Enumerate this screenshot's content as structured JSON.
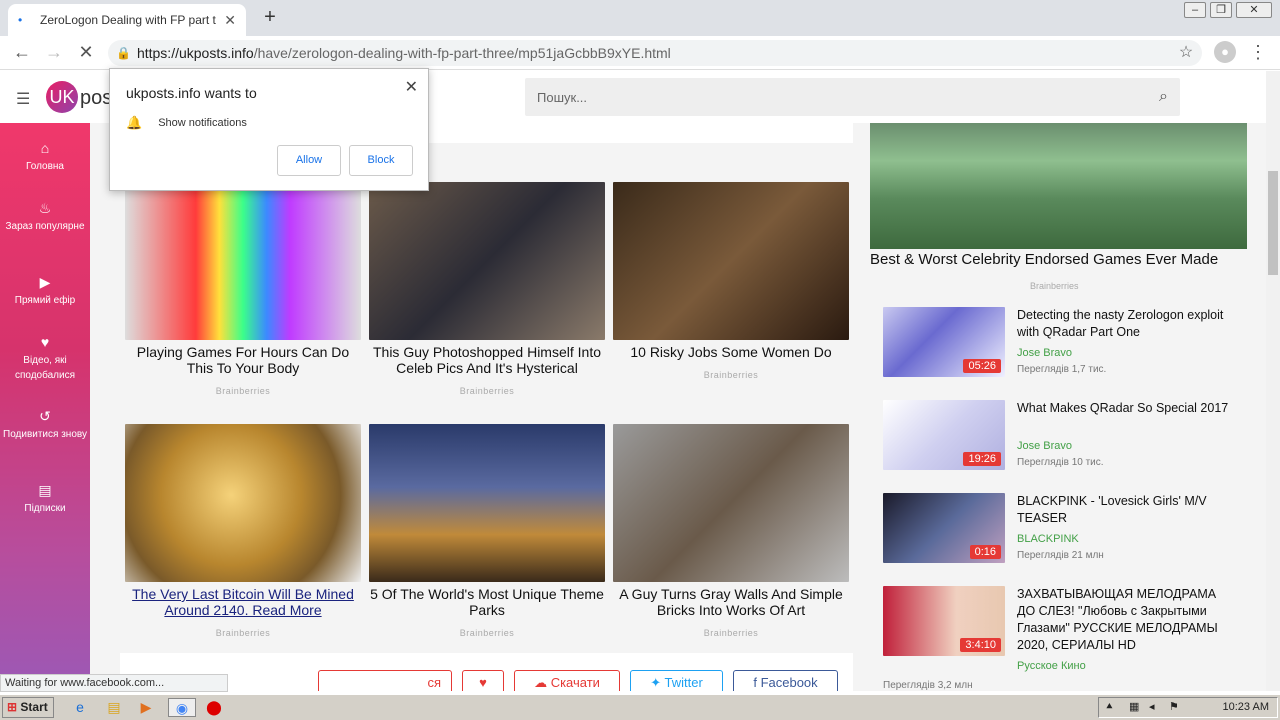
{
  "browser": {
    "tab_title": "ZeroLogon Dealing with FP part thre",
    "url_host": "https://ukposts.info",
    "url_path": "/have/zerologon-dealing-with-fp-part-three/mp51jaGcbbB9xYE.html",
    "status_text": "Waiting for www.facebook.com..."
  },
  "popup": {
    "title": "ukposts.info wants to",
    "permission": "Show notifications",
    "allow_label": "Allow",
    "block_label": "Block"
  },
  "site": {
    "logo_badge": "UK",
    "logo_text": "post",
    "search_placeholder": "Пошук..."
  },
  "sidebar": {
    "items": [
      {
        "label": "Головна",
        "icon": "home-icon"
      },
      {
        "label": "Зараз популярне",
        "icon": "fire-icon"
      },
      {
        "label": "Прямий ефір",
        "icon": "live-icon"
      },
      {
        "label": "Відео, які сподобалися",
        "icon": "heart-icon"
      },
      {
        "label": "Подивитися знову",
        "icon": "history-icon"
      },
      {
        "label": "Підписки",
        "icon": "folder-icon"
      }
    ]
  },
  "cards": [
    {
      "caption": "Playing Games For Hours Can Do This To Your Body",
      "source": "Brainberries"
    },
    {
      "caption": "This Guy Photoshopped Himself Into Celeb Pics And It's Hysterical",
      "source": "Brainberries"
    },
    {
      "caption": "10 Risky Jobs Some Women Do",
      "source": "Brainberries"
    },
    {
      "caption": "The Very Last Bitcoin Will Be Mined Around 2140. Read More",
      "source": "Brainberries"
    },
    {
      "caption": "5 Of The World's Most Unique Theme Parks",
      "source": "Brainberries"
    },
    {
      "caption": "A Guy Turns Gray Walls And Simple Bricks Into Works Of Art",
      "source": "Brainberries"
    }
  ],
  "actions": {
    "subscribe_partial": "ся",
    "download_label": "Скачати",
    "twitter_label": "Twitter",
    "facebook_label": "Facebook"
  },
  "right": {
    "featured_caption": "Best & Worst Celebrity Endorsed Games Ever Made",
    "featured_source": "Brainberries",
    "videos": [
      {
        "title": "Detecting the nasty Zerologon exploit with QRadar Part One",
        "channel": "Jose Bravo",
        "views": "Переглядів 1,7 тис.",
        "duration": "05:26"
      },
      {
        "title": "What Makes QRadar So Special 2017",
        "channel": "Jose Bravo",
        "views": "Переглядів 10 тис.",
        "duration": "19:26"
      },
      {
        "title": "BLACKPINK - 'Lovesick Girls' M/V TEASER",
        "channel": "BLACKPINK",
        "views": "Переглядів 21 млн",
        "duration": "0:16"
      },
      {
        "title": "ЗАХВАТЫВАЮЩАЯ МЕЛОДРАМА ДО СЛЕЗ! \"Любовь с Закрытыми Глазами\" РУССКИЕ МЕЛОДРАМЫ 2020, СЕРИАЛЫ HD",
        "channel": "Русское Кино",
        "views": "Переглядів 3,2 млн",
        "duration": "3:4:10"
      }
    ]
  },
  "taskbar": {
    "start_label": "Start",
    "clock": "10:23 AM"
  }
}
